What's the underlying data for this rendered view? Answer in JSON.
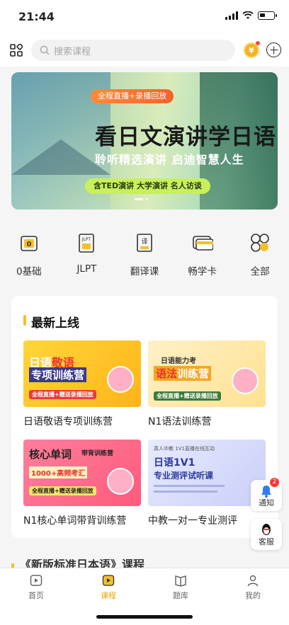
{
  "status": {
    "time": "21:44"
  },
  "topbar": {
    "search_placeholder": "搜索课程",
    "coin_text": "¥"
  },
  "banner": {
    "tag": "全程直播+录播回放",
    "title": "看日文演讲学日语",
    "subtitle": "聆听精选演讲 启迪智慧人生",
    "tag2": "含TED演讲 大学演讲 名人访谈"
  },
  "categories": [
    {
      "label": "0基础",
      "icon": "folder-zero-icon"
    },
    {
      "label": "JLPT",
      "icon": "jlpt-doc-icon"
    },
    {
      "label": "翻译课",
      "icon": "translate-icon"
    },
    {
      "label": "畅学卡",
      "icon": "card-icon"
    },
    {
      "label": "全部",
      "icon": "all-grid-icon"
    }
  ],
  "new_section": {
    "title": "最新上线",
    "courses": [
      {
        "title": "日语敬语专项训练营",
        "thumb_line1": "日语",
        "thumb_highlight": "敬语",
        "thumb_line2": "专项训练营",
        "thumb_note": "全程直播+赠送录播回放"
      },
      {
        "title": "N1语法训练营",
        "thumb_line1": "日语能力考",
        "thumb_highlight": "语法",
        "thumb_line2": "训练营",
        "thumb_note": "全程直播+赠送录播回放"
      },
      {
        "title": "N1核心单词带背训练营",
        "thumb_line1": "核心单词",
        "thumb_highlight": "带背训练营",
        "thumb_line2": "1000+高频考汇",
        "thumb_note": "全程直播+赠送录播回放"
      },
      {
        "title": "中教一对一专业测评",
        "thumb_line1": "日语1V1",
        "thumb_highlight": "专业测评试听课",
        "thumb_line2": "真人中教 1V1直播在线互动",
        "thumb_note": ""
      }
    ]
  },
  "floating": {
    "notify_label": "通知",
    "notify_count": "2",
    "service_label": "客服"
  },
  "next_section": {
    "title": "《新版标准日本语》课程"
  },
  "tabs": [
    {
      "label": "首页",
      "active": false
    },
    {
      "label": "课程",
      "active": true
    },
    {
      "label": "题库",
      "active": false
    },
    {
      "label": "我的",
      "active": false
    }
  ],
  "colors": {
    "accent": "#f0a500",
    "banner_tag": "#f4622b",
    "section_bar": "#f4c02a",
    "badge": "#ff3333"
  }
}
